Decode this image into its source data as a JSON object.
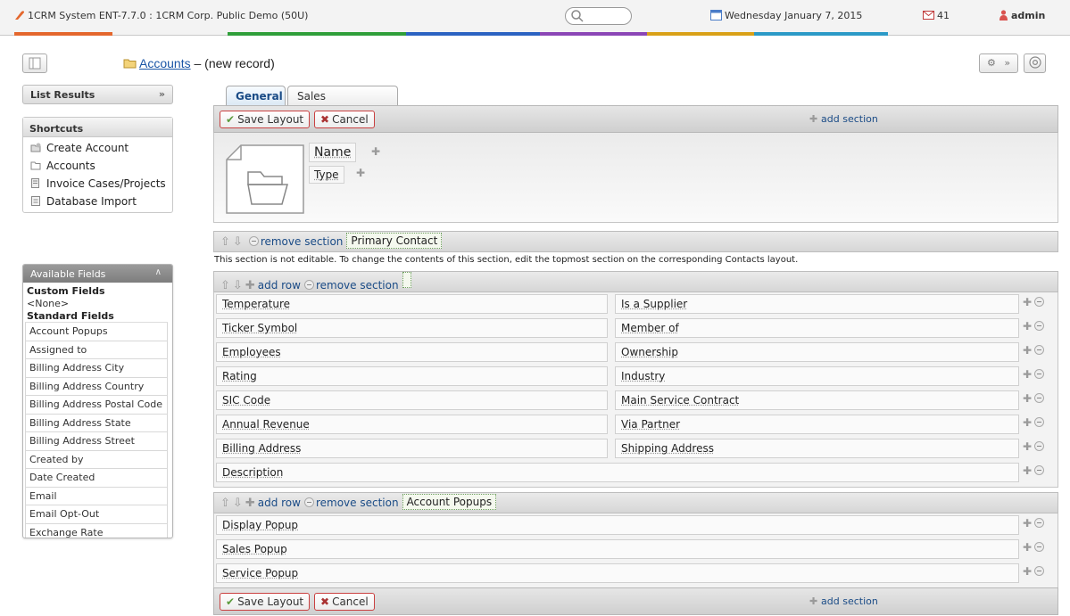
{
  "topbar": {
    "title": "1CRM System ENT-7.7.0 : 1CRM Corp. Public Demo (50U)",
    "date": "Wednesday January 7, 2015",
    "mail_count": "41",
    "user": "admin",
    "accent_segments": [
      "#e4672d",
      "#2f9f3a",
      "#2b63c2",
      "#8b46b6",
      "#d9a118",
      "#2c9ac7"
    ]
  },
  "header": {
    "module_link": "Accounts",
    "title_suffix": " – (new record)"
  },
  "sidebar": {
    "list_results": "List Results",
    "shortcuts_title": "Shortcuts",
    "shortcuts": [
      {
        "label": "Create Account",
        "icon": "create-account-icon"
      },
      {
        "label": "Accounts",
        "icon": "folder-icon"
      },
      {
        "label": "Invoice Cases/Projects",
        "icon": "invoice-icon"
      },
      {
        "label": "Database Import",
        "icon": "import-icon"
      }
    ],
    "available_fields_title": "Available Fields",
    "custom_fields_title": "Custom Fields",
    "custom_fields_none": "<None>",
    "standard_fields_title": "Standard Fields",
    "standard_fields": [
      "Account Popups",
      "Assigned to",
      "Billing Address City",
      "Billing Address Country",
      "Billing Address Postal Code",
      "Billing Address State",
      "Billing Address Street",
      "Created by",
      "Date Created",
      "Email",
      "Email Opt-Out",
      "Exchange Rate"
    ]
  },
  "tabs": [
    {
      "label": "General",
      "active": true
    },
    {
      "label": "Sales Information",
      "active": false
    }
  ],
  "toolbar": {
    "save_label": "Save Layout",
    "cancel_label": "Cancel",
    "add_section_label": "add section"
  },
  "header_fields": [
    "Name",
    "Type"
  ],
  "primary_contact": {
    "remove_label": "remove section",
    "section_name": "Primary Contact",
    "note": "This section is not editable. To change the contents of this section, edit the topmost section on the corresponding Contacts layout."
  },
  "main_section": {
    "add_row_label": "add row",
    "remove_label": "remove section",
    "section_name": "",
    "rows": [
      [
        "Temperature",
        "Is a Supplier"
      ],
      [
        "Ticker Symbol",
        "Member of"
      ],
      [
        "Employees",
        "Ownership"
      ],
      [
        "Rating",
        "Industry"
      ],
      [
        "SIC Code",
        "Main Service Contract"
      ],
      [
        "Annual Revenue",
        "Via Partner"
      ],
      [
        "Billing Address",
        "Shipping Address"
      ],
      [
        "Description"
      ]
    ]
  },
  "popup_section": {
    "add_row_label": "add row",
    "remove_label": "remove section",
    "section_name": "Account Popups",
    "rows": [
      "Display Popup",
      "Sales Popup",
      "Service Popup"
    ]
  }
}
